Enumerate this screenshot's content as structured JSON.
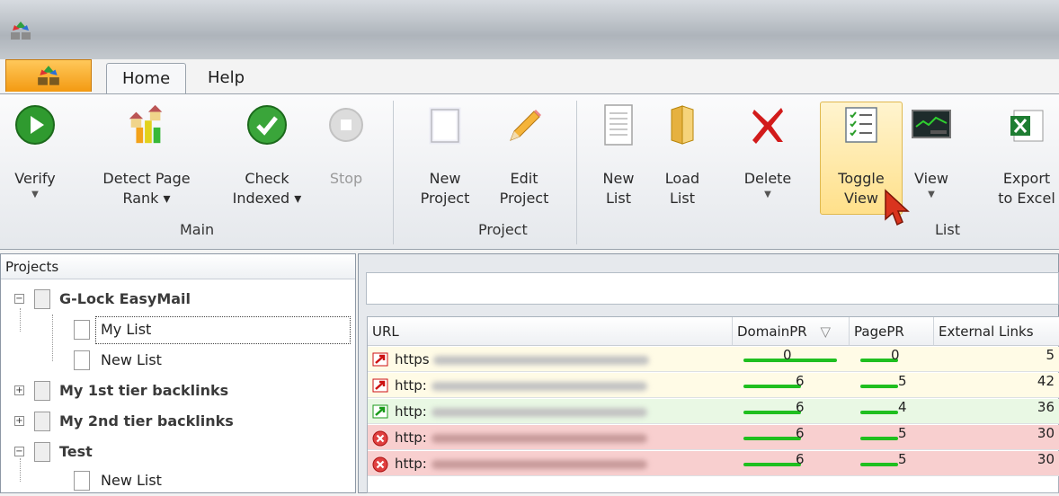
{
  "window": {
    "app_icon": "app-logo-icon"
  },
  "tabs": {
    "app_menu_icon": "app-logo-icon",
    "home": "Home",
    "help": "Help"
  },
  "ribbon": {
    "verify": "Verify",
    "detect_page_rank_1": "Detect Page",
    "detect_page_rank_2": "Rank ▾",
    "check_indexed_1": "Check",
    "check_indexed_2": "Indexed ▾",
    "stop": "Stop",
    "group_main": "Main",
    "new_project_1": "New",
    "new_project_2": "Project",
    "edit_project_1": "Edit",
    "edit_project_2": "Project",
    "group_project": "Project",
    "new_list_1": "New",
    "new_list_2": "List",
    "load_list_1": "Load",
    "load_list_2": "List",
    "delete": "Delete",
    "toggle_view_1": "Toggle",
    "toggle_view_2": "View",
    "view": "View",
    "group_list": "List",
    "export_1": "Export",
    "export_2": "to Excel"
  },
  "projects": {
    "header": "Projects",
    "items": [
      {
        "label": "G-Lock EasyMail",
        "expanded": true
      },
      {
        "label": "My List",
        "selected": true
      },
      {
        "label": "New List"
      },
      {
        "label": "My 1st tier backlinks",
        "expanded": false
      },
      {
        "label": "My 2nd tier backlinks",
        "expanded": false
      },
      {
        "label": "Test",
        "expanded": true
      },
      {
        "label": "New List"
      }
    ]
  },
  "grid": {
    "columns": [
      "URL",
      "DomainPR",
      "PagePR",
      "External Links"
    ],
    "sort_indicator": "▽",
    "rows": [
      {
        "status": "external-link-red-icon",
        "url": "https",
        "domain_pr": "0",
        "page_pr": "0",
        "external_links": "5",
        "bg": "#fffbe6"
      },
      {
        "status": "external-link-red-icon",
        "url": "http:",
        "domain_pr": "6",
        "page_pr": "5",
        "external_links": "42",
        "bg": "#fffbe6"
      },
      {
        "status": "external-link-green-icon",
        "url": "http:",
        "domain_pr": "6",
        "page_pr": "4",
        "external_links": "36",
        "bg": "#e9f8e4"
      },
      {
        "status": "error-circle-icon",
        "url": "http:",
        "domain_pr": "6",
        "page_pr": "5",
        "external_links": "30",
        "bg": "#f8cfcf"
      },
      {
        "status": "error-circle-icon",
        "url": "http:",
        "domain_pr": "6",
        "page_pr": "5",
        "external_links": "30",
        "bg": "#f8cfcf"
      }
    ]
  }
}
